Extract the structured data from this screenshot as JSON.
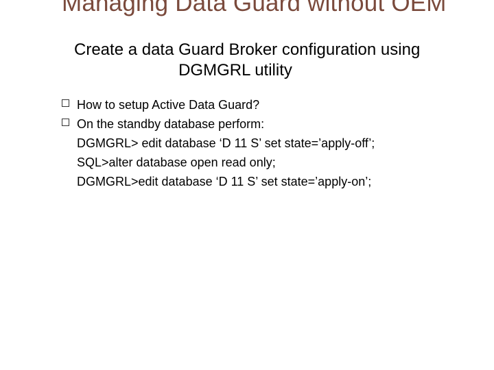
{
  "title": "Managing Data Guard without OEM",
  "subtitle_line1": "Create a data Guard Broker configuration using",
  "subtitle_line2": "DGMGRL utility",
  "bullets": [
    "How to setup Active Data Guard?",
    "On the standby database perform:"
  ],
  "code_lines": [
    "DGMGRL> edit database ‘D 11 S’ set state=’apply-off’;",
    "SQL>alter database open read only;",
    "DGMGRL>edit database ‘D 11 S’ set state=’apply-on’;"
  ]
}
